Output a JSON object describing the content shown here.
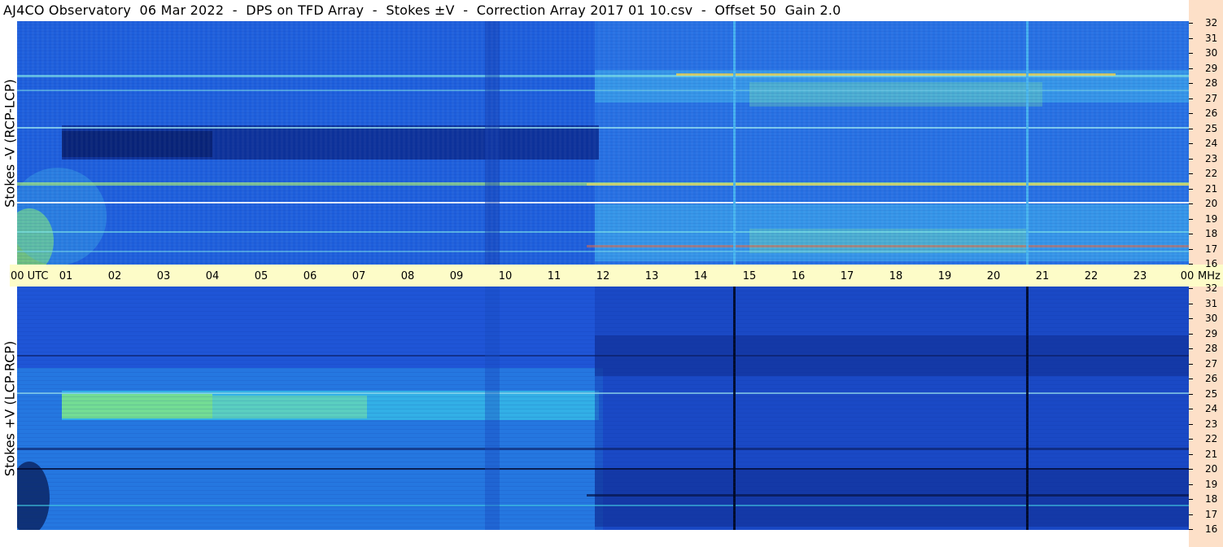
{
  "header": {
    "title": "AJ4CO Observatory  06 Mar 2022  -  DPS on TFD Array  -  Stokes ±V  -  Correction Array 2017 01 10.csv  -  Offset 50  Gain 2.0"
  },
  "panels": {
    "top": {
      "label": "Stokes -V (RCP-LCP)"
    },
    "bottom": {
      "label": "Stokes +V (LCP-RCP)"
    }
  },
  "time_axis": {
    "ticks": [
      "00  UTC",
      "01",
      "02",
      "03",
      "04",
      "05",
      "06",
      "07",
      "08",
      "09",
      "10",
      "11",
      "12",
      "13",
      "14",
      "15",
      "16",
      "17",
      "18",
      "19",
      "20",
      "21",
      "22",
      "23",
      "00"
    ],
    "unit": "MHz"
  },
  "freq_axis": {
    "ticks": [
      "32",
      "31",
      "30",
      "29",
      "28",
      "27",
      "26",
      "25",
      "24",
      "23",
      "22",
      "21",
      "20",
      "19",
      "18",
      "17",
      "16"
    ]
  },
  "colors": {
    "top_base": "#1e5fdc",
    "bottom_base": "#1f55d6",
    "axis_band": "#fdfcc8",
    "side_strip": "#fde0c8"
  }
}
